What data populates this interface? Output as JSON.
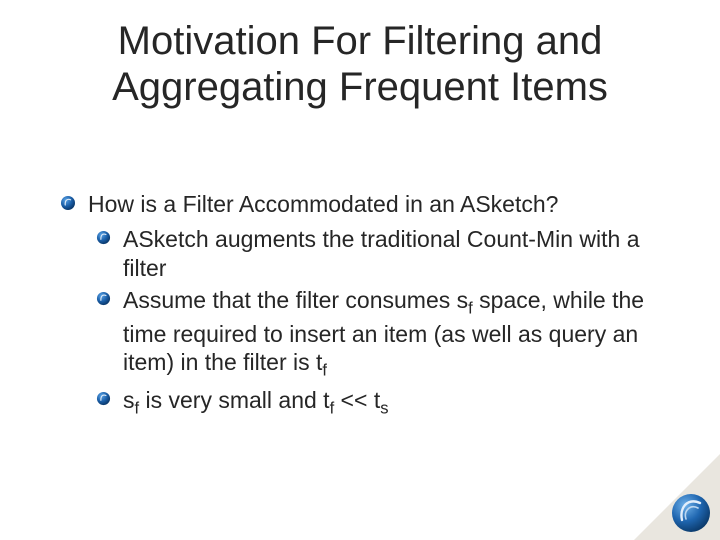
{
  "title": "Motivation For Filtering and Aggregating Frequent Items",
  "bullets": {
    "main": "How is a Filter Accommodated in an ASketch?",
    "sub1": "ASketch augments the traditional Count-Min with a filter",
    "sub2_a": "Assume that the filter consumes s",
    "sub2_b": "  space, while the time required to insert an item (as well as query an item) in the filter is t",
    "sub3_a": "s",
    "sub3_b": " is very small and  t",
    "sub3_c": " <<  t",
    "f": "f",
    "s": "s"
  }
}
